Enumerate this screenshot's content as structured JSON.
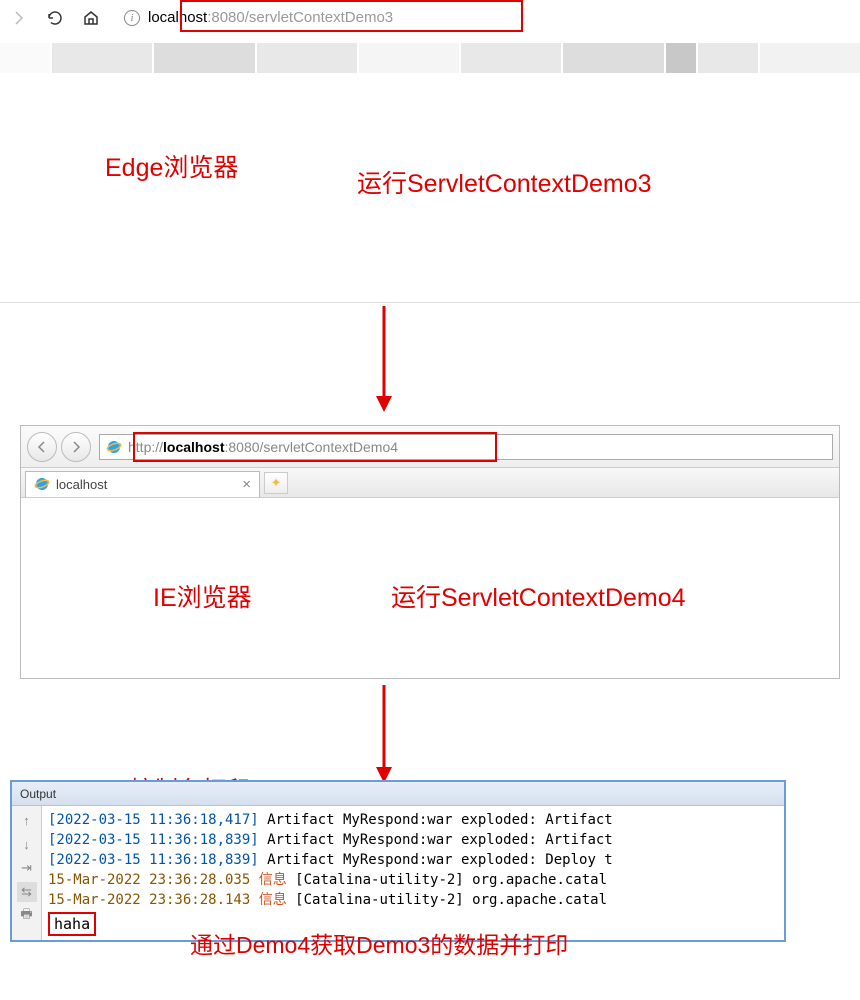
{
  "edge": {
    "url_host": "localhost",
    "url_port": ":8080",
    "url_path": "/servletContextDemo3"
  },
  "labels": {
    "edge_browser": "Edge浏览器",
    "run_demo3": "运行ServletContextDemo3",
    "ie_browser": "IE浏览器",
    "run_demo4": "运行ServletContextDemo4",
    "console_print": "控制台打印",
    "bottom_caption": "通过Demo4获取Demo3的数据并打印"
  },
  "ie": {
    "url_prefix": "http://",
    "url_host": "localhost",
    "url_rest": ":8080/servletContextDemo4",
    "tab_title": "localhost",
    "tab_close": "×"
  },
  "output": {
    "title": "Output",
    "lines": [
      {
        "ts": "[2022-03-15 11:36:18,417]",
        "rest": " Artifact MyRespond:war exploded: Artifact"
      },
      {
        "ts": "[2022-03-15 11:36:18,839]",
        "rest": " Artifact MyRespond:war exploded: Artifact"
      },
      {
        "ts": "[2022-03-15 11:36:18,839]",
        "rest": " Artifact MyRespond:war exploded: Deploy t"
      }
    ],
    "cn_lines": [
      {
        "ts": "15-Mar-2022 23:36:28.035",
        "info": " 信息 ",
        "rest": "[Catalina-utility-2] org.apache.catal"
      },
      {
        "ts": "15-Mar-2022 23:36:28.143",
        "info": " 信息 ",
        "rest": "[Catalina-utility-2] org.apache.catal"
      }
    ],
    "haha": "haha"
  }
}
